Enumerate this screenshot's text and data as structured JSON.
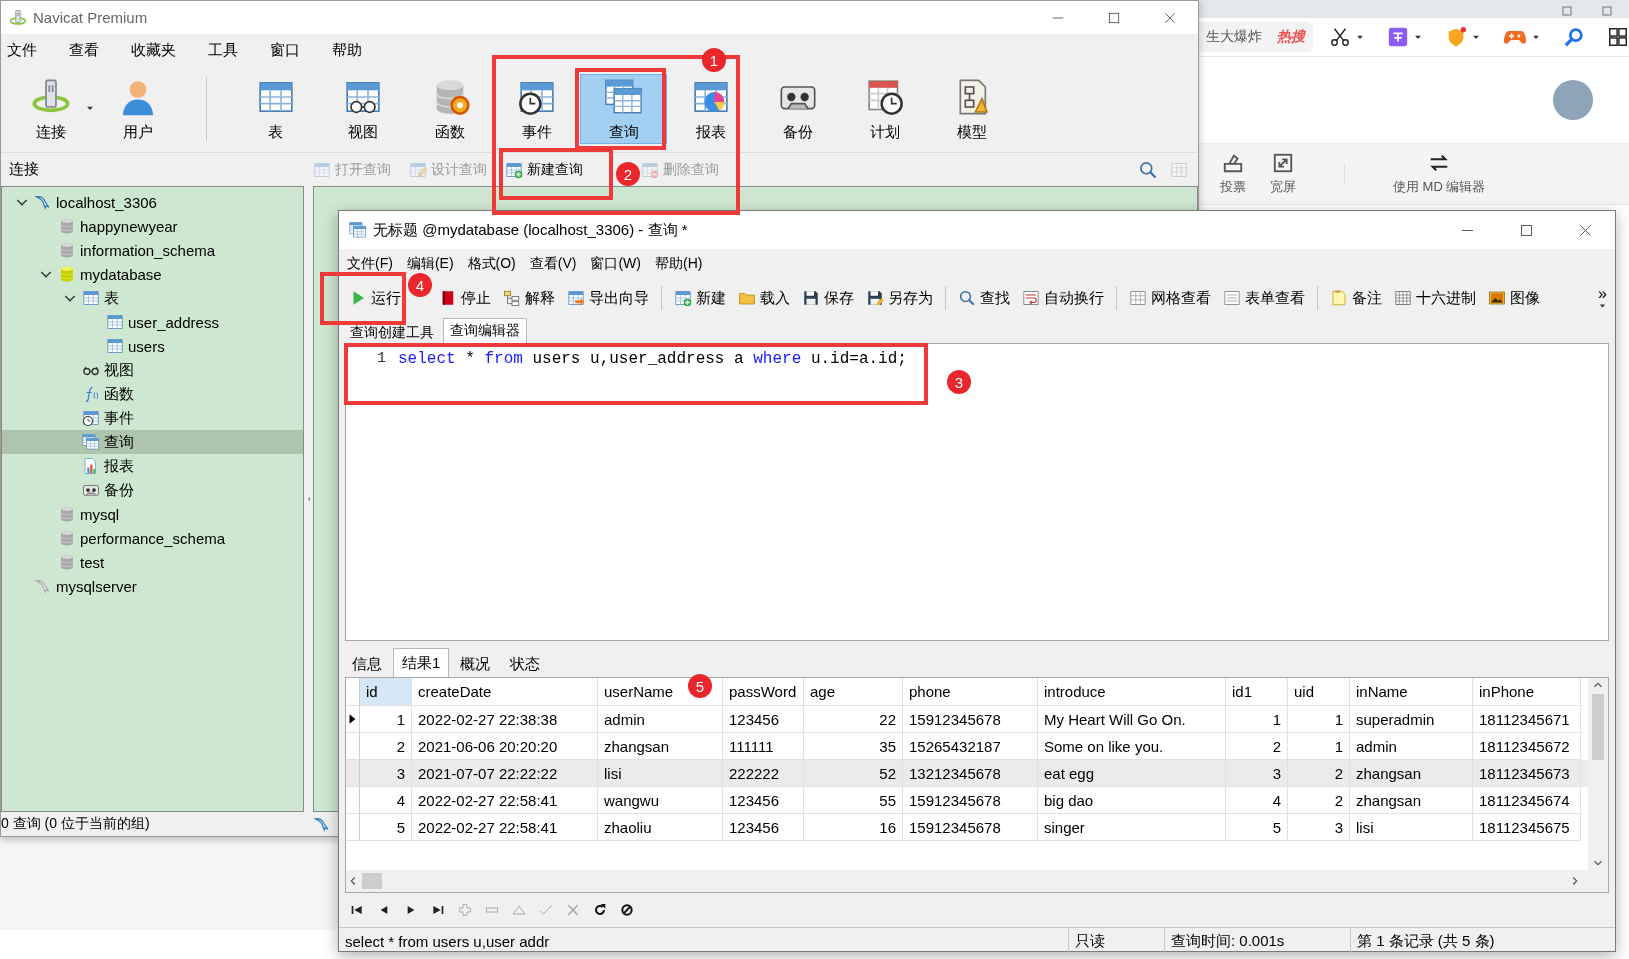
{
  "main_window": {
    "title": "Navicat Premium",
    "menu": [
      "文件",
      "查看",
      "收藏夹",
      "工具",
      "窗口",
      "帮助"
    ],
    "toolbar": [
      {
        "label": "连接",
        "kind": "connection",
        "selected": false,
        "dropdown": true
      },
      {
        "label": "用户",
        "kind": "user",
        "selected": false
      },
      {
        "kind": "separator"
      },
      {
        "label": "表",
        "kind": "table",
        "selected": false
      },
      {
        "label": "视图",
        "kind": "view",
        "selected": false
      },
      {
        "label": "函数",
        "kind": "function",
        "selected": false
      },
      {
        "label": "事件",
        "kind": "event",
        "selected": false
      },
      {
        "label": "查询",
        "kind": "query",
        "selected": true
      },
      {
        "label": "报表",
        "kind": "report",
        "selected": false
      },
      {
        "label": "备份",
        "kind": "backup",
        "selected": false
      },
      {
        "label": "计划",
        "kind": "schedule",
        "selected": false
      },
      {
        "label": "模型",
        "kind": "model",
        "selected": false
      }
    ],
    "sidebar_header": "连接",
    "object_actions": [
      {
        "label": "打开查询",
        "kind": "open-query",
        "disabled": true
      },
      {
        "label": "设计查询",
        "kind": "design-query",
        "disabled": true
      },
      {
        "label": "新建查询",
        "kind": "new-query",
        "disabled": false
      },
      {
        "label": "删除查询",
        "kind": "delete-query",
        "disabled": true
      }
    ],
    "tree": [
      {
        "label": "localhost_3306",
        "kind": "server",
        "selected": false,
        "expanded": true,
        "children": [
          {
            "label": "happynewyear",
            "kind": "database",
            "selected": false
          },
          {
            "label": "information_schema",
            "kind": "database",
            "selected": false
          },
          {
            "label": "mydatabase",
            "kind": "database-open",
            "selected": false,
            "expanded": true,
            "children": [
              {
                "label": "表",
                "kind": "table",
                "selected": false,
                "expanded": true,
                "children": [
                  {
                    "label": "user_address",
                    "kind": "table",
                    "selected": false
                  },
                  {
                    "label": "users",
                    "kind": "table",
                    "selected": false
                  }
                ]
              },
              {
                "label": "视图",
                "kind": "views",
                "selected": false
              },
              {
                "label": "函数",
                "kind": "functions",
                "selected": false
              },
              {
                "label": "事件",
                "kind": "event",
                "selected": false
              },
              {
                "label": "查询",
                "kind": "query",
                "selected": true
              },
              {
                "label": "报表",
                "kind": "reports",
                "selected": false
              },
              {
                "label": "备份",
                "kind": "backup",
                "selected": false
              }
            ]
          },
          {
            "label": "mysql",
            "kind": "database",
            "selected": false
          },
          {
            "label": "performance_schema",
            "kind": "database",
            "selected": false
          },
          {
            "label": "test",
            "kind": "database",
            "selected": false
          }
        ]
      },
      {
        "label": "mysqlserver",
        "kind": "server-off",
        "selected": false
      }
    ],
    "status_bar": "0 查询 (0 位于当前的组)"
  },
  "query_window": {
    "title": "无标题 @mydatabase (localhost_3306) - 查询 *",
    "menu": [
      "文件(F)",
      "编辑(E)",
      "格式(O)",
      "查看(V)",
      "窗口(W)",
      "帮助(H)"
    ],
    "toolbar": [
      {
        "label": "运行",
        "kind": "run"
      },
      {
        "label": "停止",
        "kind": "stop"
      },
      {
        "label": "解释",
        "kind": "explain"
      },
      {
        "label": "导出向导",
        "kind": "export"
      },
      {
        "kind": "separator"
      },
      {
        "label": "新建",
        "kind": "new-query"
      },
      {
        "label": "载入",
        "kind": "load"
      },
      {
        "label": "保存",
        "kind": "save"
      },
      {
        "label": "另存为",
        "kind": "saveas"
      },
      {
        "kind": "separator"
      },
      {
        "label": "查找",
        "kind": "find"
      },
      {
        "label": "自动换行",
        "kind": "wrap"
      },
      {
        "kind": "separator"
      },
      {
        "label": "网格查看",
        "kind": "gridview"
      },
      {
        "label": "表单查看",
        "kind": "form"
      },
      {
        "kind": "separator"
      },
      {
        "label": "备注",
        "kind": "note"
      },
      {
        "label": "十六进制",
        "kind": "hex"
      },
      {
        "label": "图像",
        "kind": "image"
      }
    ],
    "toolbar_overflow": "»",
    "editor_tabs": [
      {
        "label": "查询创建工具",
        "selected": false
      },
      {
        "label": "查询编辑器",
        "selected": true
      }
    ],
    "editor": {
      "line_numbers": [
        "1"
      ],
      "code": [
        {
          "text": "select",
          "kind": "keyword"
        },
        {
          "text": " * ",
          "kind": "plain"
        },
        {
          "text": "from",
          "kind": "keyword"
        },
        {
          "text": " users u,user_address a ",
          "kind": "plain"
        },
        {
          "text": "where",
          "kind": "keyword"
        },
        {
          "text": " u.id=a.id;",
          "kind": "plain"
        }
      ]
    },
    "result_tabs": [
      {
        "label": "信息",
        "selected": false
      },
      {
        "label": "结果1",
        "selected": true
      },
      {
        "label": "概况",
        "selected": false
      },
      {
        "label": "状态",
        "selected": false
      }
    ],
    "grid": {
      "columns": [
        {
          "label": "id",
          "kind": "number",
          "selected": true
        },
        {
          "label": "createDate",
          "kind": "text",
          "selected": false
        },
        {
          "label": "userName",
          "kind": "text",
          "selected": false
        },
        {
          "label": "passWord",
          "kind": "text",
          "selected": false
        },
        {
          "label": "age",
          "kind": "number",
          "selected": false
        },
        {
          "label": "phone",
          "kind": "text",
          "selected": false
        },
        {
          "label": "introduce",
          "kind": "text",
          "selected": false
        },
        {
          "label": "id1",
          "kind": "number",
          "selected": false
        },
        {
          "label": "uid",
          "kind": "number",
          "selected": false
        },
        {
          "label": "inName",
          "kind": "text",
          "selected": false
        },
        {
          "label": "inPhone",
          "kind": "text",
          "selected": false
        }
      ],
      "rows": [
        {
          "current": true,
          "selected": false,
          "cells": [
            "1",
            "2022-02-27 22:38:38",
            "admin",
            "123456",
            "22",
            "15912345678",
            "My Heart Will Go On.",
            "1",
            "1",
            "superadmin",
            "18112345671"
          ]
        },
        {
          "current": false,
          "selected": false,
          "cells": [
            "2",
            "2021-06-06 20:20:20",
            "zhangsan",
            "111111",
            "35",
            "15265432187",
            "Some on like you.",
            "2",
            "1",
            "admin",
            "18112345672"
          ]
        },
        {
          "current": false,
          "selected": true,
          "cells": [
            "3",
            "2021-07-07 22:22:22",
            "lisi",
            "222222",
            "52",
            "13212345678",
            "eat egg",
            "3",
            "2",
            "zhangsan",
            "18112345673"
          ]
        },
        {
          "current": false,
          "selected": false,
          "cells": [
            "4",
            "2022-02-27 22:58:41",
            "wangwu",
            "123456",
            "55",
            "15912345678",
            "big dao",
            "4",
            "2",
            "zhangsan",
            "18112345674"
          ]
        },
        {
          "current": false,
          "selected": false,
          "cells": [
            "5",
            "2022-02-27 22:58:41",
            "zhaoliu",
            "123456",
            "16",
            "15912345678",
            "singer",
            "5",
            "3",
            "lisi",
            "18112345675"
          ]
        }
      ]
    },
    "navigator": [
      {
        "kind": "first",
        "disabled": false
      },
      {
        "kind": "prev",
        "disabled": false
      },
      {
        "kind": "next",
        "disabled": false
      },
      {
        "kind": "last",
        "disabled": false
      },
      {
        "kind": "add",
        "disabled": true
      },
      {
        "kind": "remove",
        "disabled": true
      },
      {
        "kind": "up",
        "disabled": true
      },
      {
        "kind": "confirm",
        "disabled": true
      },
      {
        "kind": "cancel",
        "disabled": true
      },
      {
        "kind": "refresh",
        "disabled": false
      },
      {
        "kind": "halt",
        "disabled": false
      }
    ],
    "status_bar": [
      "select * from users u,user addr",
      "只读",
      "查询时间: 0.001s",
      "第 1 条记录 (共 5 条)"
    ]
  },
  "browser": {
    "search_text": "生大爆炸",
    "hot_badge": "热搜",
    "tools": [
      {
        "label": "投票",
        "kind": "vote"
      },
      {
        "label": "宽屏",
        "kind": "widescreen"
      },
      {
        "kind": "separator"
      },
      {
        "label": "使用 MD 编辑器",
        "kind": "markdown"
      }
    ]
  },
  "annotations": {
    "markers": [
      "1",
      "2",
      "3",
      "4",
      "5"
    ]
  }
}
